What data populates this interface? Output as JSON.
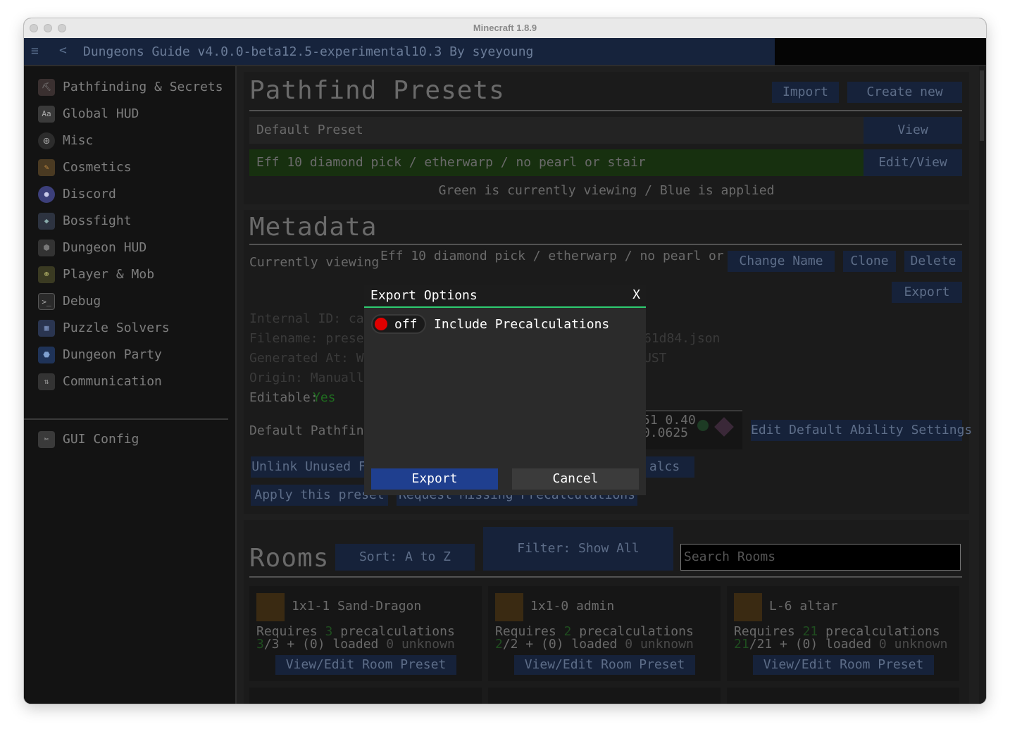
{
  "window": {
    "title": "Minecraft 1.8.9"
  },
  "app": {
    "title": "Dungeons Guide v4.0.0-beta12.5-experimental10.3 By syeyoung"
  },
  "sidebar": {
    "items": [
      {
        "label": "Pathfinding & Secrets",
        "icon": "pickaxe-icon"
      },
      {
        "label": "Global HUD",
        "icon": "font-icon"
      },
      {
        "label": "Misc",
        "icon": "plus-circle-icon"
      },
      {
        "label": "Cosmetics",
        "icon": "brush-icon"
      },
      {
        "label": "Discord",
        "icon": "discord-icon"
      },
      {
        "label": "Bossfight",
        "icon": "dragon-icon"
      },
      {
        "label": "Dungeon HUD",
        "icon": "cube-icon"
      },
      {
        "label": "Player & Mob",
        "icon": "zombie-icon"
      },
      {
        "label": "Debug",
        "icon": "terminal-icon"
      },
      {
        "label": "Puzzle Solvers",
        "icon": "grid-icon"
      },
      {
        "label": "Dungeon Party",
        "icon": "party-icon"
      },
      {
        "label": "Communication",
        "icon": "arrows-icon"
      }
    ],
    "footer": {
      "label": "GUI Config",
      "icon": "wrench-icon"
    }
  },
  "presets": {
    "title": "Pathfind Presets",
    "import_label": "Import",
    "create_label": "Create new",
    "rows": [
      {
        "name": "Default Preset",
        "action": "View",
        "bg": "#232323"
      },
      {
        "name": "Eff 10 diamond pick / etherwarp / no pearl or stair",
        "action": "Edit/View",
        "bg": "#17300f"
      }
    ],
    "hint": "Green is currently viewing / Blue is applied"
  },
  "metadata": {
    "title": "Metadata",
    "currently_viewing_label": "Currently viewing",
    "currently_viewing_value": "Eff 10 diamond pick / etherwarp / no pearl or",
    "change_name_label": "Change Name",
    "clone_label": "Clone",
    "delete_label": "Delete",
    "export_label": "Export",
    "internal_id": "Internal ID: cae",
    "filename_left": "Filename: preset",
    "filename_right": "61d84.json",
    "generated_left": "Generated At: We",
    "generated_right": "UST",
    "origin": "Origin: Manually",
    "editable_label": "Editable:",
    "editable_value": "Yes",
    "default_pathfind_label": "Default Pathfind",
    "ability_line1": "51 0.40",
    "ability_line2": "0.0625",
    "edit_default_label": "Edit Default Ability Settings",
    "unlink_label": "Unlink Unused F",
    "precalcs_label": "alcs",
    "apply_label": "Apply this preset",
    "request_label": "Request Missing Precalculations"
  },
  "rooms": {
    "title": "Rooms",
    "sort_label": "Sort: A to Z",
    "filter_label": "Filter: Show All",
    "search_placeholder": "Search Rooms",
    "cards": [
      {
        "name": "1x1-1 Sand-Dragon",
        "req_prefix": "Requires",
        "req_count": "3",
        "req_suffix": "precalculations",
        "loaded_have": "3",
        "loaded_rest": "/3 + (0) loaded",
        "unknown_count": "0",
        "unknown_label": "unknown",
        "button": "View/Edit Room Preset"
      },
      {
        "name": "1x1-0 admin",
        "req_prefix": "Requires",
        "req_count": "2",
        "req_suffix": "precalculations",
        "loaded_have": "2",
        "loaded_rest": "/2 + (0) loaded",
        "unknown_count": "0",
        "unknown_label": "unknown",
        "button": "View/Edit Room Preset"
      },
      {
        "name": "L-6 altar",
        "req_prefix": "Requires",
        "req_count": "21",
        "req_suffix": "precalculations",
        "loaded_have": "21",
        "loaded_rest": "/21 + (0) loaded",
        "unknown_count": "0",
        "unknown_label": "unknown",
        "button": "View/Edit Room Preset"
      }
    ]
  },
  "modal": {
    "title": "Export Options",
    "close_label": "X",
    "toggle_state": "off",
    "option_label": "Include Precalculations",
    "export_label": "Export",
    "cancel_label": "Cancel"
  },
  "colors": {
    "accent_green": "#2ecc71",
    "toggle_off": "#e00000",
    "primary_button": "#1f3f8f",
    "secondary_button": "#3b3b3b"
  }
}
